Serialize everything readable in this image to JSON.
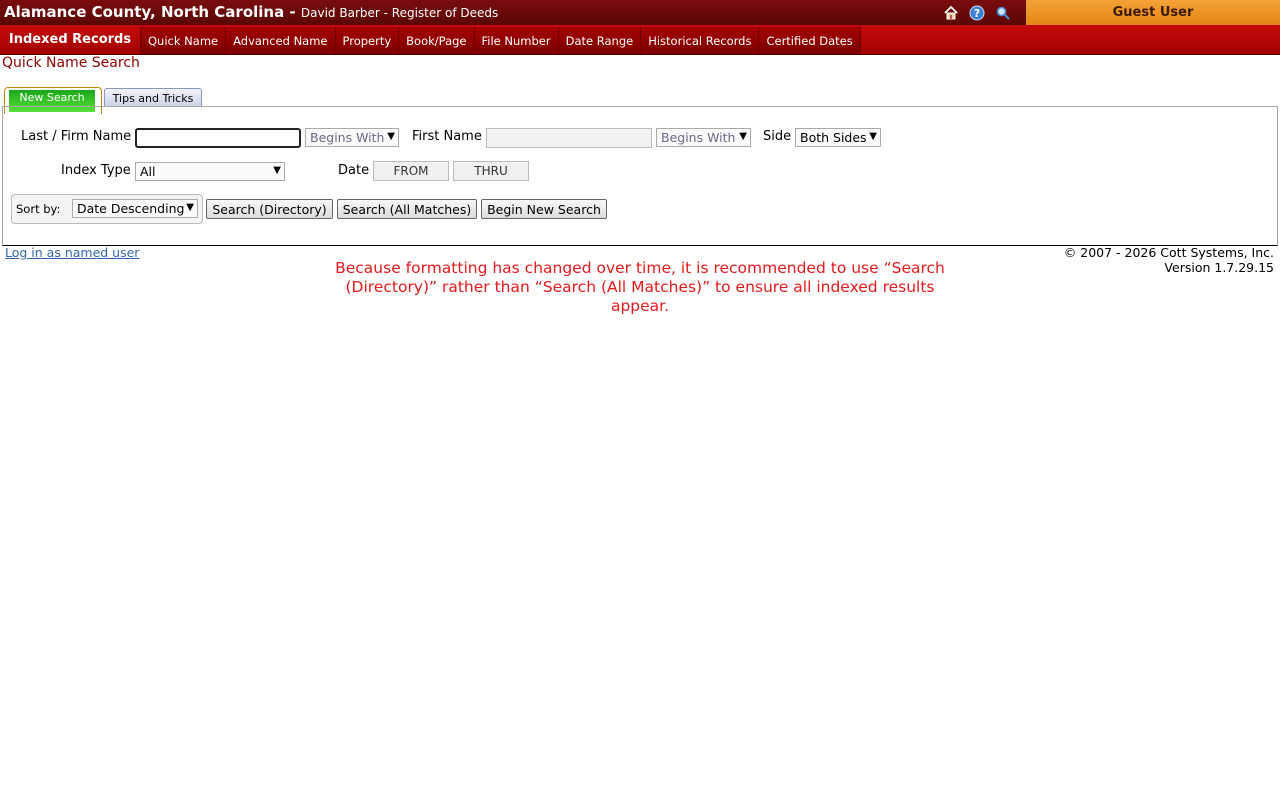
{
  "header": {
    "county": "Alamance County, North Carolina -",
    "subtitle": "David Barber - Register of Deeds",
    "guest_label": "Guest User"
  },
  "nav": {
    "main": "Indexed Records",
    "items": [
      "Quick Name",
      "Advanced Name",
      "Property",
      "Book/Page",
      "File Number",
      "Date Range",
      "Historical Records",
      "Certified Dates"
    ]
  },
  "page": {
    "title": "Quick Name Search"
  },
  "tabs": {
    "new_search": "New Search",
    "tips": "Tips and Tricks"
  },
  "form": {
    "last_name_label": "Last / Firm Name",
    "last_name_value": "",
    "last_match": "Begins With",
    "first_name_label": "First Name",
    "first_name_value": "",
    "first_match": "Begins With",
    "side_label": "Side",
    "side_value": "Both Sides",
    "index_type_label": "Index Type",
    "index_type_value": "All",
    "date_label": "Date",
    "date_from": "FROM",
    "date_thru": "THRU",
    "sort_label": "Sort by:",
    "sort_value": "Date Descending",
    "btn_directory": "Search (Directory)",
    "btn_all": "Search (All Matches)",
    "btn_new": "Begin New Search"
  },
  "footer": {
    "login": "Log in as named user",
    "copyright": "© 2007 - 2026 Cott Systems, Inc.",
    "version": "Version 1.7.29.15",
    "notice": "Because formatting has changed over time, it is recommended to use “Search (Directory)” rather than “Search (All Matches)” to ensure all indexed results appear."
  }
}
